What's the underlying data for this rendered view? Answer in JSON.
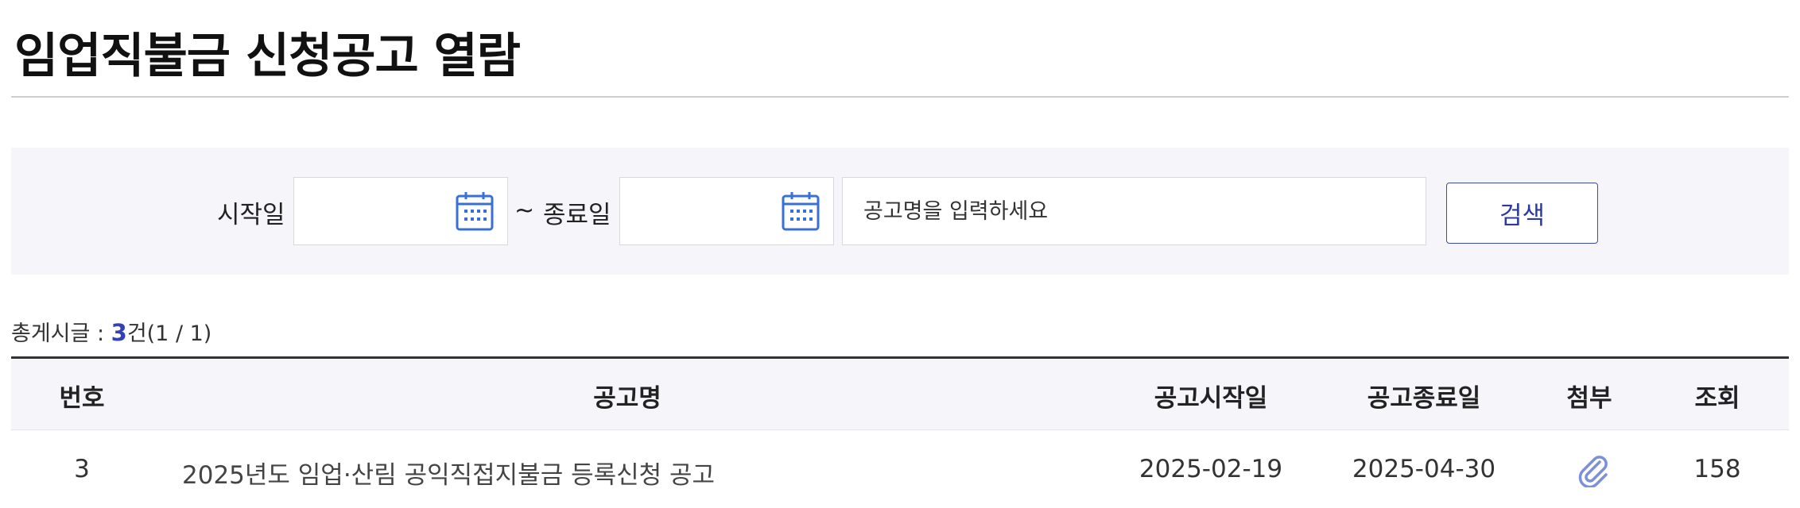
{
  "page": {
    "title": "임업직불금 신청공고 열람"
  },
  "search": {
    "start_label": "시작일",
    "separator": "~",
    "end_label": "종료일",
    "keyword_placeholder": "공고명을 입력하세요",
    "start_value": "",
    "end_value": "",
    "button_label": "검색",
    "calendar_icon": "calendar-icon"
  },
  "summary": {
    "prefix": "총게시글 : ",
    "count": "3",
    "suffix": "건(1 / 1)"
  },
  "table": {
    "headers": [
      "번호",
      "공고명",
      "공고시작일",
      "공고종료일",
      "첨부",
      "조회"
    ],
    "rows": [
      {
        "no": "3",
        "title": "2025년도 임업·산림 공익직접지불금 등록신청 공고",
        "start": "2025-02-19",
        "end": "2025-04-30",
        "attachment_icon": "paperclip-icon",
        "views": "158"
      }
    ]
  },
  "colors": {
    "accent": "#3341b5",
    "icon_blue": "#3a6fd6",
    "panel_bg": "#f6f6fa"
  }
}
